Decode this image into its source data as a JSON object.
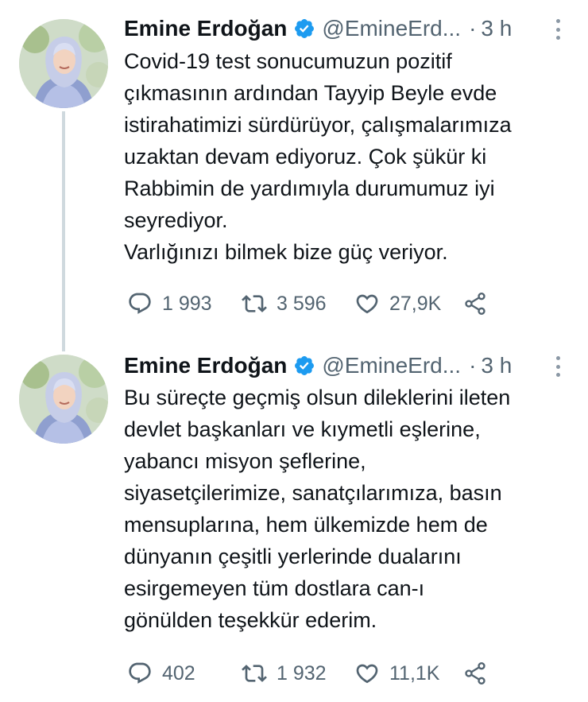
{
  "tweets": [
    {
      "author_name": "Emine Erdoğan",
      "author_handle": "@EmineErd...",
      "time_separator": "·",
      "time": "3 h",
      "text_lines": [
        "Covid-19 test sonucumuzun pozitif",
        "çıkmasının ardından Tayyip Beyle evde",
        "istirahatimizi sürdürüyor, çalışmalarımıza",
        "uzaktan devam ediyoruz. Çok şükür ki",
        "Rabbimin de yardımıyla durumumuz iyi",
        "seyrediyor.",
        "Varlığınızı bilmek bize güç veriyor."
      ],
      "replies": "1 993",
      "retweets": "3 596",
      "likes": "27,9K"
    },
    {
      "author_name": "Emine Erdoğan",
      "author_handle": "@EmineErd...",
      "time_separator": "·",
      "time": "3 h",
      "text_lines": [
        "Bu süreçte geçmiş olsun dileklerini ileten",
        "devlet başkanları ve kıymetli eşlerine,",
        "yabancı misyon şeflerine,",
        "siyasetçilerimize, sanatçılarımıza, basın",
        "mensuplarına, hem ülkemizde hem de",
        "dünyanın çeşitli yerlerinde dualarını",
        "esirgemeyen tüm dostlara can-ı",
        "gönülden teşekkür ederim."
      ],
      "replies": "402",
      "retweets": "1 932",
      "likes": "11,1K"
    }
  ],
  "icons": {
    "verified": "verified-badge-icon",
    "more": "more-vertical-icon",
    "reply": "reply-icon",
    "retweet": "retweet-icon",
    "like": "heart-icon",
    "share": "share-icon"
  },
  "colors": {
    "verified_blue": "#1d9bf0",
    "secondary_text": "#536471",
    "thread_line": "#cfd9de"
  }
}
